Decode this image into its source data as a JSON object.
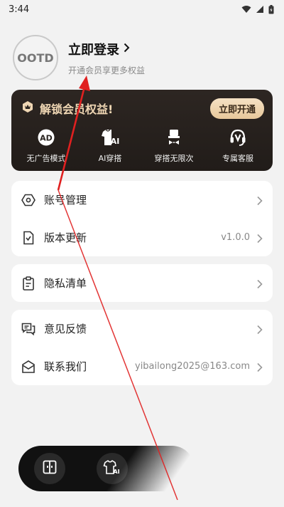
{
  "status_bar": {
    "time": "3:44"
  },
  "profile": {
    "avatar_text": "OOTD",
    "login_title": "立即登录",
    "login_subtitle": "开通会员享更多权益"
  },
  "vip": {
    "title": "解锁会员权益!",
    "open_button": "立即开通",
    "perks": [
      {
        "label": "无广告模式",
        "icon": "ad-icon"
      },
      {
        "label": "AI穿搭",
        "icon": "ai-shirt-icon"
      },
      {
        "label": "穿搭无限次",
        "icon": "hat-icon"
      },
      {
        "label": "专属客服",
        "icon": "headset-icon"
      }
    ]
  },
  "menu": {
    "account": {
      "label": "账号管理"
    },
    "version": {
      "label": "版本更新",
      "value": "v1.0.0"
    },
    "privacy": {
      "label": "隐私清单"
    },
    "feedback": {
      "label": "意见反馈"
    },
    "contact": {
      "label": "联系我们",
      "value": "yibailong2025@163.com"
    }
  },
  "colors": {
    "background": "#f2f2f2",
    "vip_card": "#2a2420",
    "vip_gold": "#f0d7b4",
    "annotation_red": "#e02020"
  }
}
